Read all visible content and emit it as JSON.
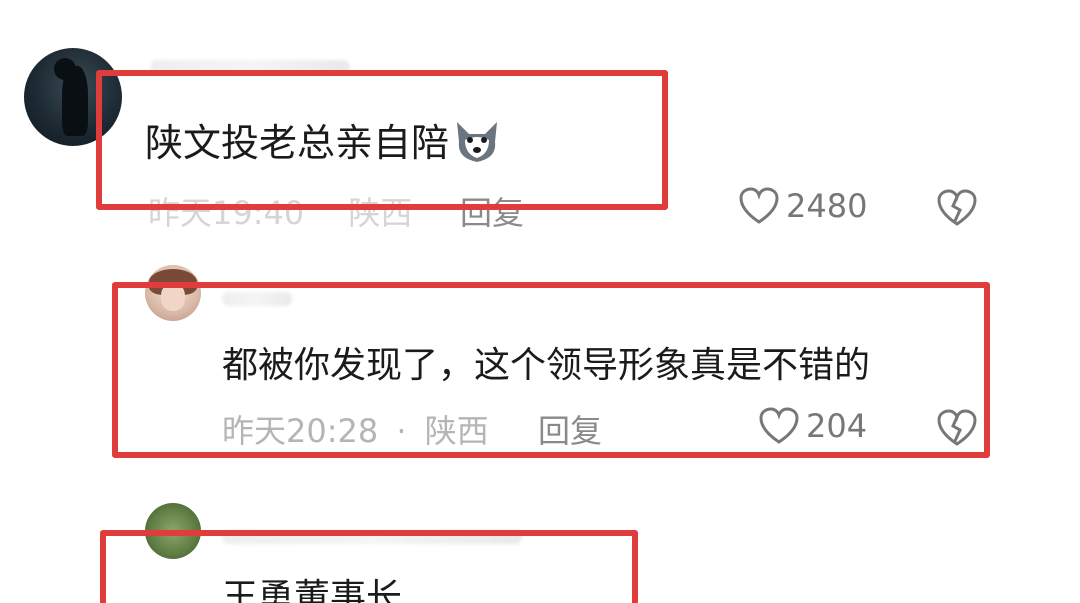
{
  "comments": [
    {
      "text": "陕文投老总亲自陪",
      "emoji": "wolf-face-emoji",
      "time": "昨天19:40",
      "location": "陕西",
      "reply": "回复",
      "likes": "2480"
    },
    {
      "text": "都被你发现了，这个领导形象真是不错的",
      "time": "昨天20:28",
      "separator": "·",
      "location": "陕西",
      "reply": "回复",
      "likes": "204"
    },
    {
      "text": "王勇董事长"
    }
  ],
  "colors": {
    "highlight_box": "#e03c3c",
    "meta_text": "#9a9a9a",
    "comment_text": "#1b1b1b"
  },
  "icons": [
    "heart-outline-icon",
    "broken-heart-icon",
    "wolf-face-emoji"
  ]
}
